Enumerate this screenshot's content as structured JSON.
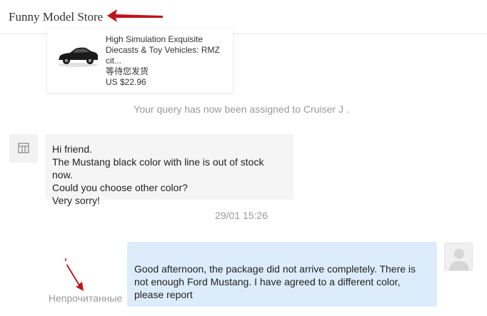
{
  "header": {
    "store_name": "Funny Model Store",
    "annotation": "red-arrow-icon"
  },
  "product_card": {
    "title": "High Simulation Exquisite Diecasts & Toy Vehicles: RMZ cit...",
    "status": "等待您发货",
    "price": "US $22.96",
    "thumbnail": "black-car-image"
  },
  "system_message": "Your query has now been assigned to Cruiser J .",
  "seller_message": {
    "avatar": "store-avatar-icon",
    "lines": [
      "Hi friend.",
      "The Mustang black color with line is out of stock now.",
      "Could you choose other color?",
      "Very sorry!"
    ]
  },
  "timestamp": "29/01 15:26",
  "buyer_message": {
    "text": "Good afternoon, the package did not arrive completely. There is not enough Ford Mustang. I have agreed to a different color, please report",
    "status": "Непрочитанные",
    "avatar": "user-avatar-icon"
  },
  "colors": {
    "annotation_red": "#c0141b",
    "buyer_bubble": "#ddecfb",
    "seller_bubble": "#f5f5f5",
    "muted_text": "#999999"
  }
}
